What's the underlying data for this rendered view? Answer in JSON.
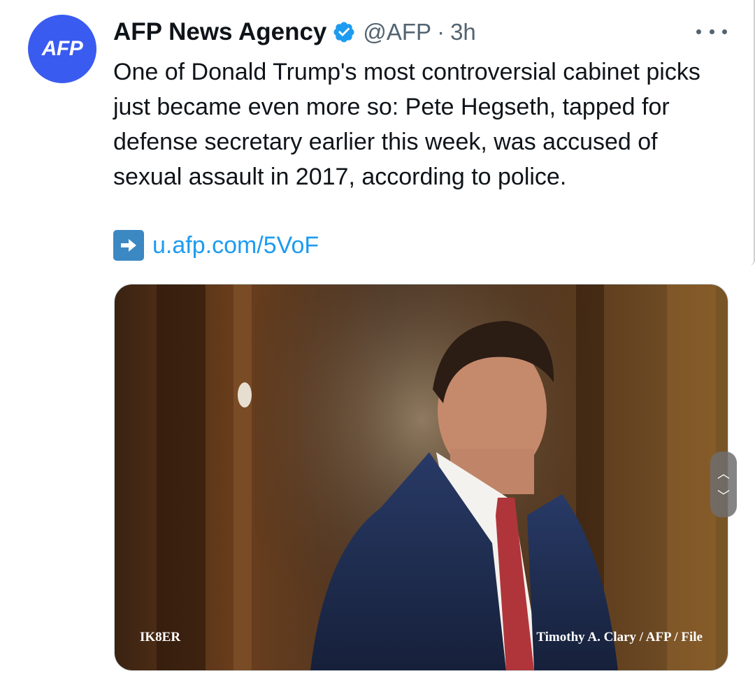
{
  "tweet": {
    "avatar_text": "AFP",
    "author_name": "AFP News Agency",
    "handle": "@AFP",
    "separator": "·",
    "time": "3h",
    "text": "One of Donald Trump's most controversial cabinet picks just became even more so: Pete Hegseth, tapped for defense secretary earlier this week, was accused of sexual assault in 2017, according to police.",
    "link": "u.afp.com/5VoF",
    "media": {
      "credit_left": "IK8ER",
      "credit_right": "Timothy A. Clary / AFP / File"
    }
  },
  "colors": {
    "avatar": "#3a5bf0",
    "verified": "#1d9bf0",
    "link": "#1d9bf0",
    "arrow_box": "#3b88c3"
  },
  "icons": {
    "verified": "verified-badge-icon",
    "more": "more-horizontal-icon",
    "link_arrow": "right-arrow-icon",
    "scroll_up": "chevron-up-icon",
    "scroll_down": "chevron-down-icon"
  }
}
